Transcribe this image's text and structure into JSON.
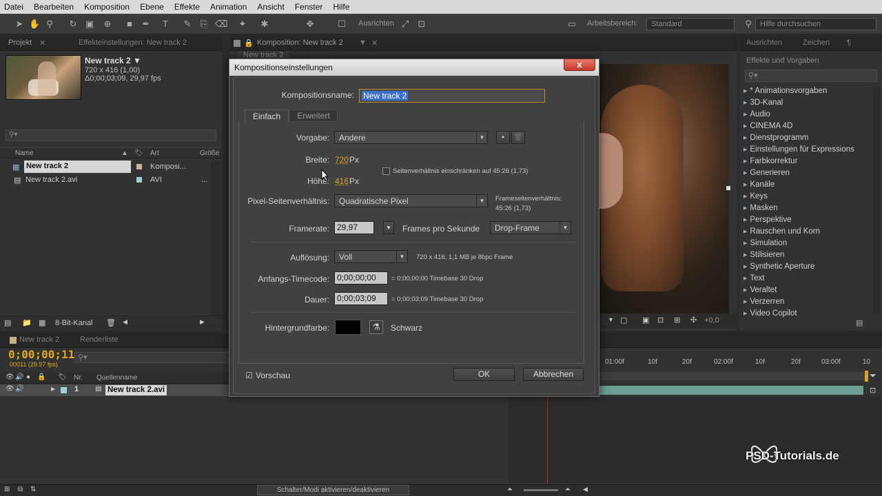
{
  "menu": [
    "Datei",
    "Bearbeiten",
    "Komposition",
    "Ebene",
    "Effekte",
    "Animation",
    "Ansicht",
    "Fenster",
    "Hilfe"
  ],
  "toolbar": {
    "align_label": "Ausrichten",
    "workspace_label": "Arbeitsbereich:",
    "workspace_value": "Standard",
    "help_search_placeholder": "Hilfe durchsuchen"
  },
  "project": {
    "tabs": [
      "Projekt",
      "Effekteinstellungen: New track 2"
    ],
    "title": "New track 2 ▼",
    "size": "720 x 416 (1,00)",
    "duration": "Δ0;00;03;09, 29,97 fps",
    "columns": {
      "name": "Name",
      "type": "Art",
      "size": "Größe"
    },
    "rows": [
      {
        "name": "New track 2",
        "type": "Komposi..."
      },
      {
        "name": "New track 2.avi",
        "type": "AVI"
      }
    ],
    "bit_depth": "8-Bit-Kanal"
  },
  "viewer": {
    "tab": "Komposition: New track 2",
    "subtab": "New track 2",
    "zoom_readout": "+0,0"
  },
  "effects": {
    "tabs": [
      "Ausrichten",
      "Zeichen"
    ],
    "panel_title": "Effekte und Vorgaben",
    "items": [
      "* Animationsvorgaben",
      "3D-Kanal",
      "Audio",
      "CINEMA 4D",
      "Dienstprogramm",
      "Einstellungen für Expressions",
      "Farbkorrektur",
      "Generieren",
      "Kanäle",
      "Keys",
      "Masken",
      "Perspektive",
      "Rauschen und Korn",
      "Simulation",
      "Stilisieren",
      "Synthetic Aperture",
      "Text",
      "Veraltet",
      "Verzerren",
      "Video Copilot"
    ]
  },
  "timeline": {
    "tabs": [
      "New track 2",
      "Renderliste"
    ],
    "timecode": "0;00;00;11",
    "fps_readout": "00011 (29.97 fps)",
    "col_nr": "Nr.",
    "col_source": "Quellenname",
    "layer_number": "1",
    "layer_name": "New track 2.avi",
    "ruler": [
      "01:00f",
      "10f",
      "20f",
      "02:00f",
      "10f",
      "20f",
      "03:00f",
      "10"
    ],
    "toggle_modes": "Schalter/Modi aktivieren/deaktivieren"
  },
  "dialog": {
    "title": "Kompositionseinstellungen",
    "close": "x",
    "comp_name_label": "Kompositionsname:",
    "comp_name_value": "New track 2",
    "tab_basic": "Einfach",
    "tab_advanced": "Erweitert",
    "preset_label": "Vorgabe:",
    "preset_value": "Andere",
    "width_label": "Breite:",
    "width_value": "720",
    "height_label": "Höhe:",
    "height_value": "416",
    "px_unit": "Px",
    "lock_ratio_label": "Seitenverhältnis einschränken auf 45:26 (1,73)",
    "par_label": "Pixel-Seitenverhältnis:",
    "par_value": "Quadratische Pixel",
    "frame_ratio_label": "Frameseitenverhältnis:",
    "frame_ratio_value": "45:26 (1,73)",
    "framerate_label": "Framerate:",
    "framerate_value": "29,97",
    "fps_label": "Frames pro Sekunde",
    "dropframe_value": "Drop-Frame",
    "resolution_label": "Auflösung:",
    "resolution_value": "Voll",
    "resolution_info": "720 x 416, 1,1 MB je 8bpc Frame",
    "start_tc_label": "Anfangs-Timecode:",
    "start_tc_value": "0;00;00;00",
    "start_tc_info": "= 0;00;00;00  Timebase 30 Drop",
    "duration_label": "Dauer:",
    "duration_value": "0;00;03;09",
    "duration_info": "= 0;00;03;09  Timebase 30 Drop",
    "bg_color_label": "Hintergrundfarbe:",
    "bg_color_name": "Schwarz",
    "bg_color_hex": "#000000",
    "preview_label": "Vorschau",
    "ok": "OK",
    "cancel": "Abbrechen"
  },
  "watermark": "PSD-Tutorials.de"
}
